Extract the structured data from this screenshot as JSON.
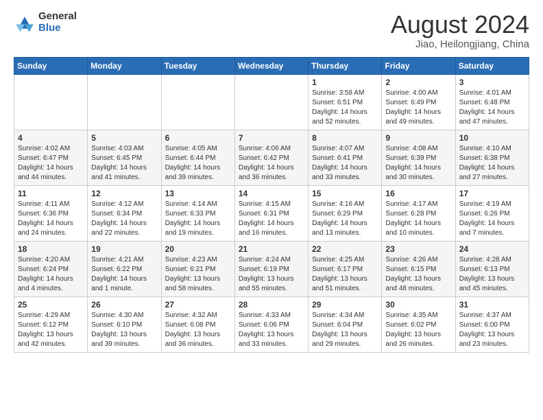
{
  "logo": {
    "general": "General",
    "blue": "Blue"
  },
  "title": "August 2024",
  "location": "Jiao, Heilongjiang, China",
  "weekdays": [
    "Sunday",
    "Monday",
    "Tuesday",
    "Wednesday",
    "Thursday",
    "Friday",
    "Saturday"
  ],
  "weeks": [
    [
      {
        "day": "",
        "info": ""
      },
      {
        "day": "",
        "info": ""
      },
      {
        "day": "",
        "info": ""
      },
      {
        "day": "",
        "info": ""
      },
      {
        "day": "1",
        "info": "Sunrise: 3:58 AM\nSunset: 6:51 PM\nDaylight: 14 hours\nand 52 minutes."
      },
      {
        "day": "2",
        "info": "Sunrise: 4:00 AM\nSunset: 6:49 PM\nDaylight: 14 hours\nand 49 minutes."
      },
      {
        "day": "3",
        "info": "Sunrise: 4:01 AM\nSunset: 6:48 PM\nDaylight: 14 hours\nand 47 minutes."
      }
    ],
    [
      {
        "day": "4",
        "info": "Sunrise: 4:02 AM\nSunset: 6:47 PM\nDaylight: 14 hours\nand 44 minutes."
      },
      {
        "day": "5",
        "info": "Sunrise: 4:03 AM\nSunset: 6:45 PM\nDaylight: 14 hours\nand 41 minutes."
      },
      {
        "day": "6",
        "info": "Sunrise: 4:05 AM\nSunset: 6:44 PM\nDaylight: 14 hours\nand 39 minutes."
      },
      {
        "day": "7",
        "info": "Sunrise: 4:06 AM\nSunset: 6:42 PM\nDaylight: 14 hours\nand 36 minutes."
      },
      {
        "day": "8",
        "info": "Sunrise: 4:07 AM\nSunset: 6:41 PM\nDaylight: 14 hours\nand 33 minutes."
      },
      {
        "day": "9",
        "info": "Sunrise: 4:08 AM\nSunset: 6:39 PM\nDaylight: 14 hours\nand 30 minutes."
      },
      {
        "day": "10",
        "info": "Sunrise: 4:10 AM\nSunset: 6:38 PM\nDaylight: 14 hours\nand 27 minutes."
      }
    ],
    [
      {
        "day": "11",
        "info": "Sunrise: 4:11 AM\nSunset: 6:36 PM\nDaylight: 14 hours\nand 24 minutes."
      },
      {
        "day": "12",
        "info": "Sunrise: 4:12 AM\nSunset: 6:34 PM\nDaylight: 14 hours\nand 22 minutes."
      },
      {
        "day": "13",
        "info": "Sunrise: 4:14 AM\nSunset: 6:33 PM\nDaylight: 14 hours\nand 19 minutes."
      },
      {
        "day": "14",
        "info": "Sunrise: 4:15 AM\nSunset: 6:31 PM\nDaylight: 14 hours\nand 16 minutes."
      },
      {
        "day": "15",
        "info": "Sunrise: 4:16 AM\nSunset: 6:29 PM\nDaylight: 14 hours\nand 13 minutes."
      },
      {
        "day": "16",
        "info": "Sunrise: 4:17 AM\nSunset: 6:28 PM\nDaylight: 14 hours\nand 10 minutes."
      },
      {
        "day": "17",
        "info": "Sunrise: 4:19 AM\nSunset: 6:26 PM\nDaylight: 14 hours\nand 7 minutes."
      }
    ],
    [
      {
        "day": "18",
        "info": "Sunrise: 4:20 AM\nSunset: 6:24 PM\nDaylight: 14 hours\nand 4 minutes."
      },
      {
        "day": "19",
        "info": "Sunrise: 4:21 AM\nSunset: 6:22 PM\nDaylight: 14 hours\nand 1 minute."
      },
      {
        "day": "20",
        "info": "Sunrise: 4:23 AM\nSunset: 6:21 PM\nDaylight: 13 hours\nand 58 minutes."
      },
      {
        "day": "21",
        "info": "Sunrise: 4:24 AM\nSunset: 6:19 PM\nDaylight: 13 hours\nand 55 minutes."
      },
      {
        "day": "22",
        "info": "Sunrise: 4:25 AM\nSunset: 6:17 PM\nDaylight: 13 hours\nand 51 minutes."
      },
      {
        "day": "23",
        "info": "Sunrise: 4:26 AM\nSunset: 6:15 PM\nDaylight: 13 hours\nand 48 minutes."
      },
      {
        "day": "24",
        "info": "Sunrise: 4:28 AM\nSunset: 6:13 PM\nDaylight: 13 hours\nand 45 minutes."
      }
    ],
    [
      {
        "day": "25",
        "info": "Sunrise: 4:29 AM\nSunset: 6:12 PM\nDaylight: 13 hours\nand 42 minutes."
      },
      {
        "day": "26",
        "info": "Sunrise: 4:30 AM\nSunset: 6:10 PM\nDaylight: 13 hours\nand 39 minutes."
      },
      {
        "day": "27",
        "info": "Sunrise: 4:32 AM\nSunset: 6:08 PM\nDaylight: 13 hours\nand 36 minutes."
      },
      {
        "day": "28",
        "info": "Sunrise: 4:33 AM\nSunset: 6:06 PM\nDaylight: 13 hours\nand 33 minutes."
      },
      {
        "day": "29",
        "info": "Sunrise: 4:34 AM\nSunset: 6:04 PM\nDaylight: 13 hours\nand 29 minutes."
      },
      {
        "day": "30",
        "info": "Sunrise: 4:35 AM\nSunset: 6:02 PM\nDaylight: 13 hours\nand 26 minutes."
      },
      {
        "day": "31",
        "info": "Sunrise: 4:37 AM\nSunset: 6:00 PM\nDaylight: 13 hours\nand 23 minutes."
      }
    ]
  ]
}
